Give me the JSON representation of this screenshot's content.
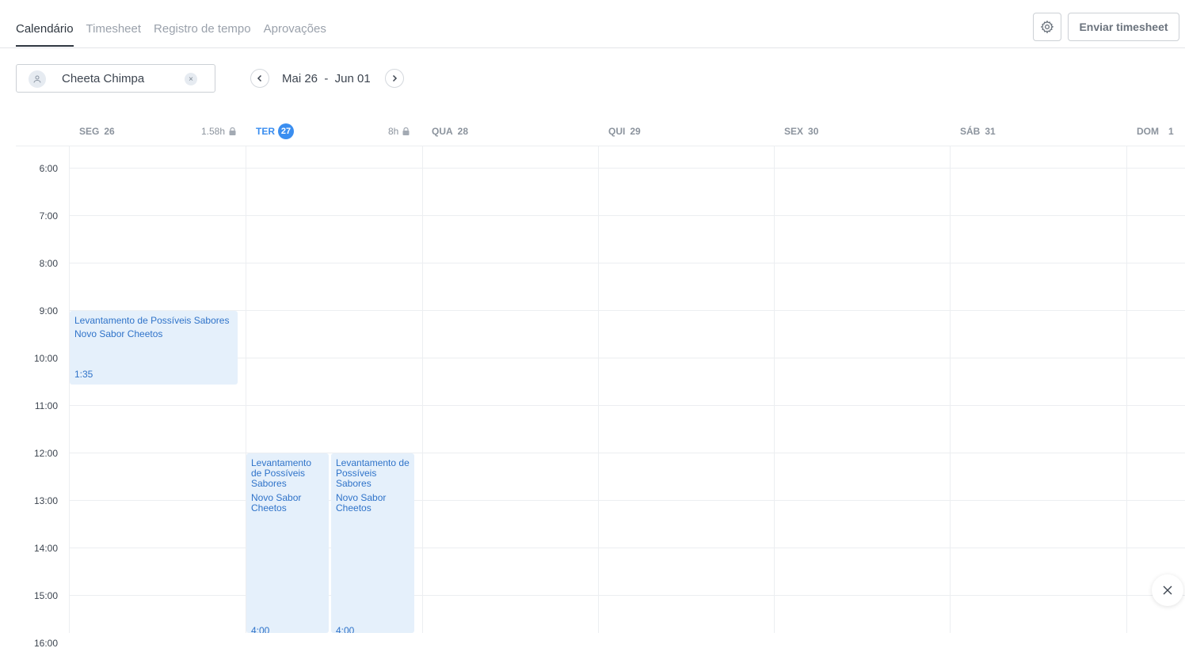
{
  "tabs": [
    {
      "label": "Calendário",
      "active": true
    },
    {
      "label": "Timesheet",
      "active": false
    },
    {
      "label": "Registro de tempo",
      "active": false
    },
    {
      "label": "Aprovações",
      "active": false
    }
  ],
  "header": {
    "settings_icon": "gear-icon",
    "submit_label": "Enviar timesheet"
  },
  "filters": {
    "user_name": "Cheeta Chimpa",
    "clear_glyph": "×",
    "date_range": "Mai 26  -  Jun 01"
  },
  "days": [
    {
      "name": "SEG",
      "num": "26",
      "total": "1.58h",
      "today": false
    },
    {
      "name": "TER",
      "num": "27",
      "total": "8h",
      "today": true
    },
    {
      "name": "QUA",
      "num": "28",
      "total": "",
      "today": false
    },
    {
      "name": "QUI",
      "num": "29",
      "total": "",
      "today": false
    },
    {
      "name": "SEX",
      "num": "30",
      "total": "",
      "today": false
    },
    {
      "name": "SÁB",
      "num": "31",
      "total": "",
      "today": false
    },
    {
      "name": "DOM",
      "num": "1",
      "total": "",
      "today": false
    }
  ],
  "hours": [
    "6:00",
    "7:00",
    "8:00",
    "9:00",
    "10:00",
    "11:00",
    "12:00",
    "13:00",
    "14:00",
    "15:00",
    "16:00"
  ],
  "events": [
    {
      "day": "SEG 26",
      "title": "Levantamento de Possíveis Sabores",
      "project": "Novo Sabor Cheetos",
      "duration": "1:35",
      "start": "9:00"
    },
    {
      "day": "TER 27",
      "title": "Levantamento de Possíveis Sabores",
      "project": "Novo Sabor Cheetos",
      "duration": "4:00",
      "start": "12:00"
    },
    {
      "day": "TER 27",
      "title": "Levantamento de Possíveis Sabores",
      "project": "Novo Sabor Cheetos",
      "duration": "4:00",
      "start": "12:00"
    }
  ],
  "colors": {
    "accent": "#3a8ef0",
    "event_bg": "#e5f0fb",
    "event_text": "#2f73c9"
  }
}
